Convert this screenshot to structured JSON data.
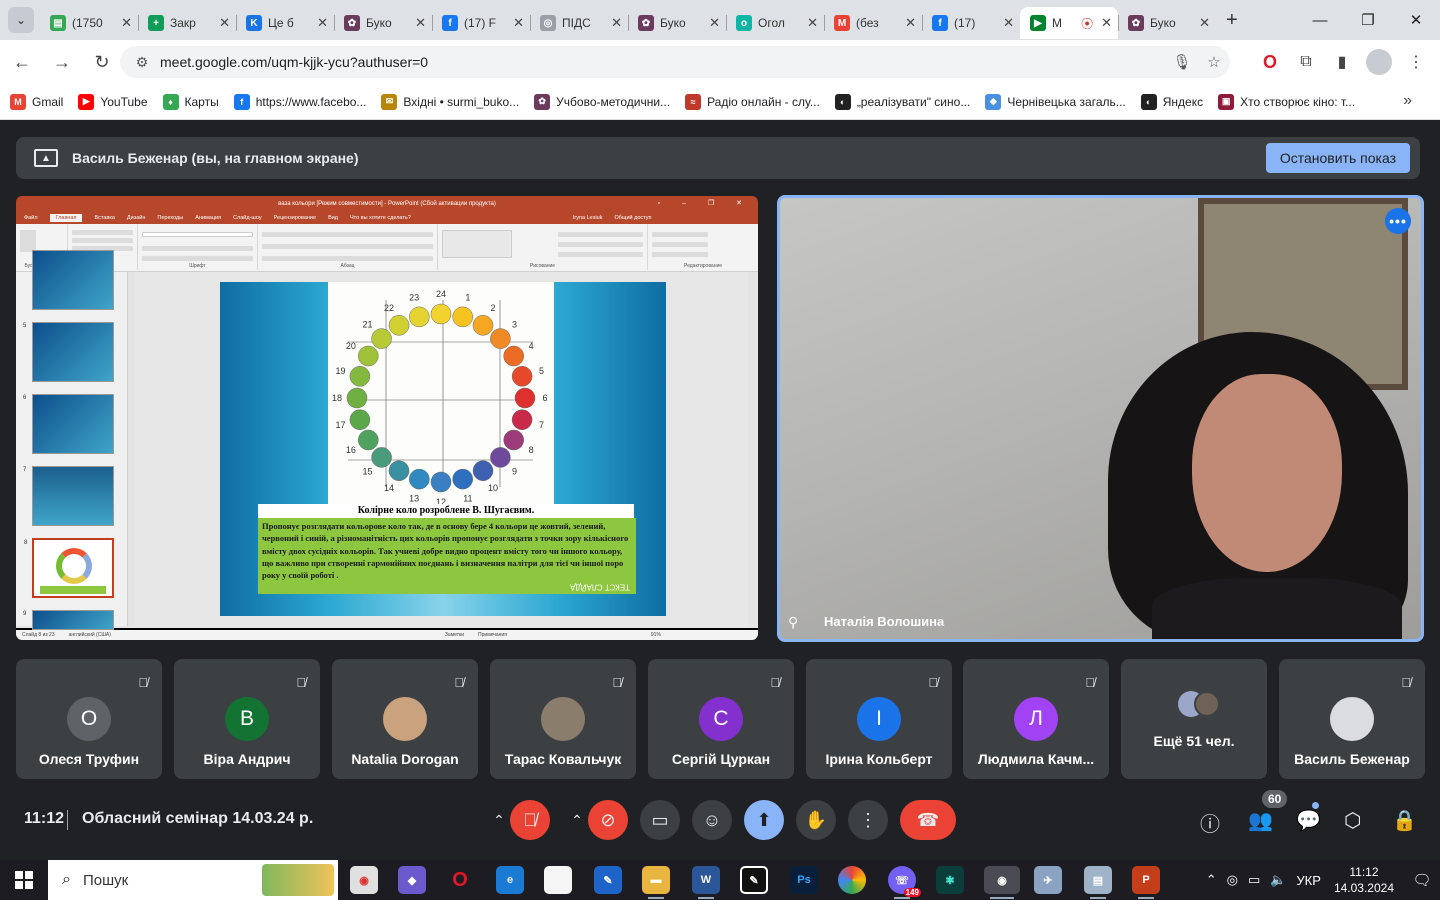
{
  "browser": {
    "tabs": [
      {
        "title": "(1750",
        "color": "#34a853",
        "glyph": "▤"
      },
      {
        "title": "Закр",
        "color": "#0f9d58",
        "glyph": "+"
      },
      {
        "title": "Це б",
        "color": "#1a73e8",
        "glyph": "K"
      },
      {
        "title": "Буко",
        "color": "#6b3b5e",
        "glyph": "✿"
      },
      {
        "title": "(17) F",
        "color": "#1877f2",
        "glyph": "f"
      },
      {
        "title": "ПІДС",
        "color": "#9aa0a6",
        "glyph": "◎"
      },
      {
        "title": "Буко",
        "color": "#6b3b5e",
        "glyph": "✿"
      },
      {
        "title": "Огол",
        "color": "#11b5a5",
        "glyph": "o"
      },
      {
        "title": "(без",
        "color": "#ea4335",
        "glyph": "M"
      },
      {
        "title": "(17)",
        "color": "#1877f2",
        "glyph": "f"
      },
      {
        "title": "M",
        "color": "#00832d",
        "glyph": "▶",
        "active": true
      },
      {
        "title": "Буко",
        "color": "#6b3b5e",
        "glyph": "✿"
      }
    ],
    "url": "meet.google.com/uqm-kjjk-ycu?authuser=0",
    "bookmarks": [
      {
        "label": "Gmail",
        "color": "#ea4335",
        "glyph": "M"
      },
      {
        "label": "YouTube",
        "color": "#ff0000",
        "glyph": "▶"
      },
      {
        "label": "Карты",
        "color": "#34a853",
        "glyph": "♦"
      },
      {
        "label": "https://www.facebo...",
        "color": "#1877f2",
        "glyph": "f"
      },
      {
        "label": "Вхідні • surmi_buko...",
        "color": "#b8860b",
        "glyph": "✉"
      },
      {
        "label": "Учбово-методични...",
        "color": "#6b3b5e",
        "glyph": "✿"
      },
      {
        "label": "Радіо онлайн - слу...",
        "color": "#c0392b",
        "glyph": "≈"
      },
      {
        "label": "„реалізувати\" сино...",
        "color": "#222222",
        "glyph": "◐"
      },
      {
        "label": "Чернівецька загаль...",
        "color": "#4a90e2",
        "glyph": "◆"
      },
      {
        "label": "Яндекс",
        "color": "#222222",
        "glyph": "◐"
      },
      {
        "label": "Хто створює кіно: т...",
        "color": "#8e1b3a",
        "glyph": "▣"
      }
    ]
  },
  "meet": {
    "presenting_text": "Василь Беженар (вы, на главном экране)",
    "stop_label": "Остановить показ",
    "speaker_name": "Наталія Волошина",
    "time": "11:12",
    "meeting_title": "Обласний семінар 14.03.24 р.",
    "participant_count": "60",
    "more_label": "Ещё 51 чел.",
    "participants": [
      {
        "name": "Олеся Труфин",
        "initial": "О",
        "color": "#5f6368"
      },
      {
        "name": "Віра Андрич",
        "initial": "В",
        "color": "#137333"
      },
      {
        "name": "Natalia Dorogan",
        "initial": "",
        "color": "#c9a27e"
      },
      {
        "name": "Тарас Ковальчук",
        "initial": "",
        "color": "#8a7d6b"
      },
      {
        "name": "Сергій Цуркан",
        "initial": "С",
        "color": "#8430ce"
      },
      {
        "name": "Ірина Кольберт",
        "initial": "І",
        "color": "#1a73e8"
      },
      {
        "name": "Людмила Качм...",
        "initial": "Л",
        "color": "#a142f4"
      },
      {
        "name": "Василь Беженар",
        "initial": "",
        "color": "#dadce0"
      }
    ]
  },
  "slide": {
    "window_title": "ваза кольори [Режим совместимости] - PowerPoint (Сбой активации продукта)",
    "ribbon_tabs": [
      "Файл",
      "Главная",
      "Вставка",
      "Дизайн",
      "Переходы",
      "Анимация",
      "Слайд-шоу",
      "Рецензирование",
      "Вид",
      "Что вы хотите сделать?",
      "Iryna Lesiuk",
      "Общий доступ"
    ],
    "ribbon_groups": [
      "Буфер обмена",
      "Слайды",
      "Шрифт",
      "Абзац",
      "Рисование",
      "Редактирование"
    ],
    "thumb_numbers": [
      "5",
      "6",
      "7",
      "8",
      "9"
    ],
    "caption": "Колірне коло розроблене В. Шугаєвим.",
    "body": "Пропонує розглядати кольорове коло так, де в основу бере 4 кольори це жовтий, зелений, червоний і синій, а різноманітність цих кольорів пропонує розглядати з точки зору кількісного вмісту двох сусідніх кольорів. Так учневі добре видно процент вмісту того чи іншого кольору, що важливо при створенні гармонійних поєднань і визначення палітри для тієї чи іншої поро року у своїй роботі .",
    "mirrored_text": "ТЕКСТ СЛАЙДА",
    "wheel_numbers": [
      "24",
      "1",
      "2",
      "3",
      "4",
      "5",
      "6",
      "7",
      "8",
      "9",
      "10",
      "11",
      "12",
      "13",
      "14",
      "15",
      "16",
      "17",
      "18",
      "19",
      "20",
      "21",
      "22",
      "23"
    ],
    "status_left": "Слайд 8 из 23",
    "status_lang": "английский (США)",
    "status_notes": "Заметки",
    "status_comments": "Примечания",
    "zoom": "91%"
  },
  "taskbar": {
    "search_placeholder": "Пошук",
    "lang": "УКР",
    "clock_time": "11:12",
    "clock_date": "14.03.2024",
    "viber_badge": "149"
  }
}
